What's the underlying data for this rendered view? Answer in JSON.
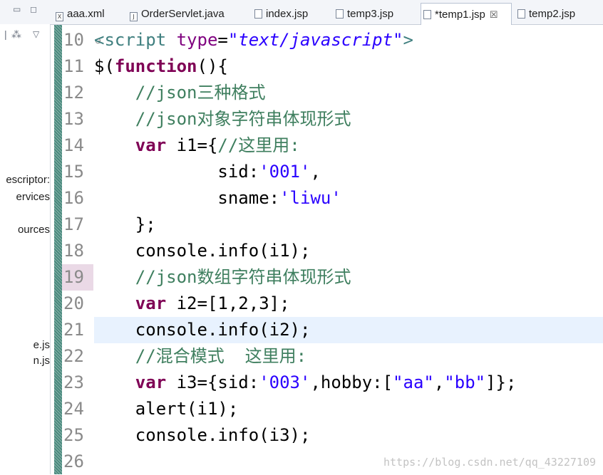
{
  "explorer": {
    "items": [
      "escriptor:",
      "ervices",
      "ources",
      "e.js",
      "n.js"
    ]
  },
  "tabs": [
    {
      "label": "aaa.xml",
      "icon": "xml-file-icon",
      "icon_glyph": "X"
    },
    {
      "label": "OrderServlet.java",
      "icon": "java-file-icon",
      "icon_glyph": "J"
    },
    {
      "label": "index.jsp",
      "icon": "jsp-file-icon",
      "icon_glyph": ""
    },
    {
      "label": "temp3.jsp",
      "icon": "jsp-file-icon",
      "icon_glyph": ""
    },
    {
      "label": "*temp1.jsp",
      "icon": "jsp-file-icon",
      "icon_glyph": "",
      "active": true
    },
    {
      "label": "temp2.jsp",
      "icon": "jsp-file-icon",
      "icon_glyph": ""
    }
  ],
  "editor": {
    "line_numbers": [
      "10",
      "11",
      "12",
      "13",
      "14",
      "15",
      "16",
      "17",
      "18",
      "19",
      "20",
      "21",
      "22",
      "23",
      "24",
      "25",
      "26"
    ],
    "current_line": "21",
    "marked_line": "19",
    "lines": [
      "<script type=\"text/javascript\">",
      "$(function(){",
      "    //json三种格式",
      "    //json对象字符串体现形式",
      "    var i1={//这里用:",
      "            sid:'001',",
      "            sname:'liwu'",
      "    };",
      "    console.info(i1);",
      "    //json数组字符串体现形式",
      "    var i2=[1,2,3];",
      "    console.info(i2);",
      "    //混合模式  这里用:",
      "    var i3={sid:'003',hobby:[\"aa\",\"bb\"]};",
      "    alert(i1);",
      "    console.info(i3);",
      ""
    ]
  },
  "watermark": "https://blog.csdn.net/qq_43227109",
  "colors": {
    "tag": "#3f7f7f",
    "attribute": "#7f007f",
    "string": "#2a00ff",
    "keyword": "#7f0055",
    "comment": "#3f7f5f",
    "current_line": "#e8f2fe"
  }
}
